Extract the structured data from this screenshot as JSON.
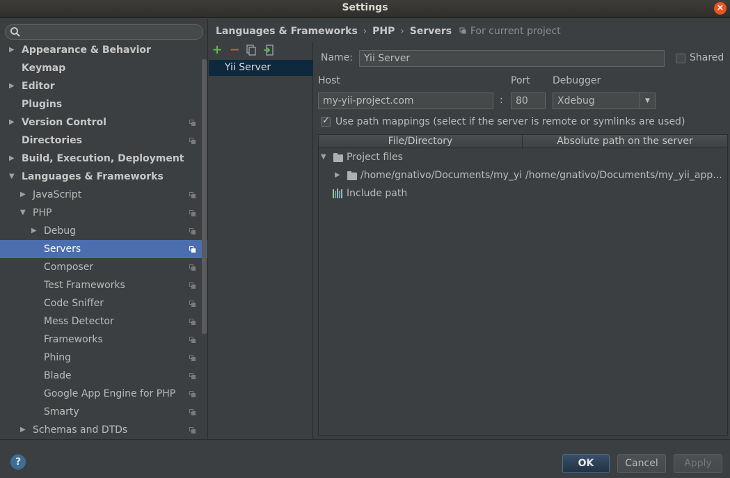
{
  "window": {
    "title": "Settings",
    "close_label": "×"
  },
  "sidebar": {
    "search_placeholder": "",
    "items": [
      {
        "label": "Appearance & Behavior",
        "bold": true,
        "indent": 0,
        "arrow": "▶",
        "proj": false
      },
      {
        "label": "Keymap",
        "bold": true,
        "indent": 0,
        "arrow": "",
        "proj": false
      },
      {
        "label": "Editor",
        "bold": true,
        "indent": 0,
        "arrow": "▶",
        "proj": false
      },
      {
        "label": "Plugins",
        "bold": true,
        "indent": 0,
        "arrow": "",
        "proj": false
      },
      {
        "label": "Version Control",
        "bold": true,
        "indent": 0,
        "arrow": "▶",
        "proj": true
      },
      {
        "label": "Directories",
        "bold": true,
        "indent": 0,
        "arrow": "",
        "proj": true
      },
      {
        "label": "Build, Execution, Deployment",
        "bold": true,
        "indent": 0,
        "arrow": "▶",
        "proj": false
      },
      {
        "label": "Languages & Frameworks",
        "bold": true,
        "indent": 0,
        "arrow": "▼",
        "proj": false
      },
      {
        "label": "JavaScript",
        "bold": false,
        "indent": 1,
        "arrow": "▶",
        "proj": true
      },
      {
        "label": "PHP",
        "bold": false,
        "indent": 1,
        "arrow": "▼",
        "proj": true
      },
      {
        "label": "Debug",
        "bold": false,
        "indent": 2,
        "arrow": "▶",
        "proj": true
      },
      {
        "label": "Servers",
        "bold": false,
        "indent": 2,
        "arrow": "",
        "proj": true,
        "selected": true
      },
      {
        "label": "Composer",
        "bold": false,
        "indent": 2,
        "arrow": "",
        "proj": true
      },
      {
        "label": "Test Frameworks",
        "bold": false,
        "indent": 2,
        "arrow": "",
        "proj": true
      },
      {
        "label": "Code Sniffer",
        "bold": false,
        "indent": 2,
        "arrow": "",
        "proj": true
      },
      {
        "label": "Mess Detector",
        "bold": false,
        "indent": 2,
        "arrow": "",
        "proj": true
      },
      {
        "label": "Frameworks",
        "bold": false,
        "indent": 2,
        "arrow": "",
        "proj": true
      },
      {
        "label": "Phing",
        "bold": false,
        "indent": 2,
        "arrow": "",
        "proj": true
      },
      {
        "label": "Blade",
        "bold": false,
        "indent": 2,
        "arrow": "",
        "proj": true
      },
      {
        "label": "Google App Engine for PHP",
        "bold": false,
        "indent": 2,
        "arrow": "",
        "proj": true
      },
      {
        "label": "Smarty",
        "bold": false,
        "indent": 2,
        "arrow": "",
        "proj": true
      },
      {
        "label": "Schemas and DTDs",
        "bold": false,
        "indent": 1,
        "arrow": "▶",
        "proj": true
      }
    ]
  },
  "breadcrumb": {
    "part1": "Languages & Frameworks",
    "part2": "PHP",
    "part3": "Servers",
    "sep": "›",
    "hint": "For current project"
  },
  "servers": {
    "toolbar": {
      "add": "+",
      "remove": "−"
    },
    "list": [
      "Yii Server"
    ]
  },
  "form": {
    "name_label": "Name:",
    "name_value": "Yii Server",
    "shared_label": "Shared",
    "shared_checked": false,
    "host_label": "Host",
    "host_value": "my-yii-project.com",
    "colon": ":",
    "port_label": "Port",
    "port_value": "80",
    "debugger_label": "Debugger",
    "debugger_value": "Xdebug",
    "path_mappings_label": "Use path mappings (select if the server is remote or symlinks are used)",
    "path_mappings_checked": true
  },
  "mapping_table": {
    "columns": [
      "File/Directory",
      "Absolute path on the server"
    ],
    "project_files_label": "Project files",
    "row": {
      "local": "/home/gnativo/Documents/my_yi",
      "remote": "/home/gnativo/Documents/my_yii_app..."
    },
    "include_path_label": "Include path"
  },
  "footer": {
    "help_label": "?",
    "ok_label": "OK",
    "cancel_label": "Cancel",
    "apply_label": "Apply"
  }
}
